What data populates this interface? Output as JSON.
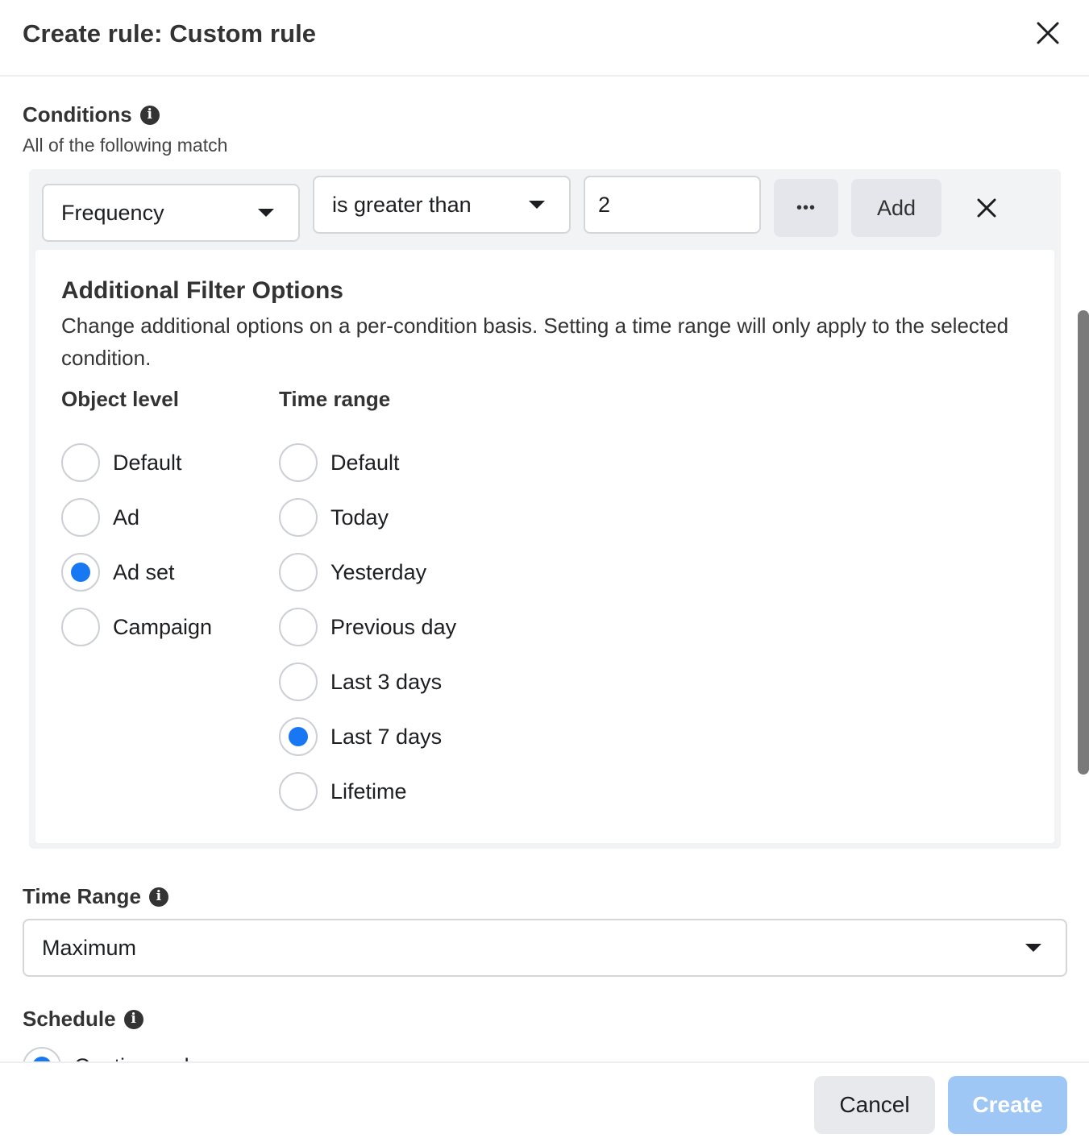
{
  "header": {
    "title": "Create rule: Custom rule",
    "close_icon": "close-icon"
  },
  "conditions": {
    "title": "Conditions",
    "subtitle": "All of the following match",
    "metric_select": "Frequency",
    "operator_select": "is greater than",
    "value_input": "2",
    "more_label": "•••",
    "add_label": "Add"
  },
  "filter_options": {
    "title": "Additional Filter Options",
    "description": "Change additional options on a per-condition basis. Setting a time range will only apply to the selected condition.",
    "object_level": {
      "title": "Object level",
      "options": [
        "Default",
        "Ad",
        "Ad set",
        "Campaign"
      ],
      "selected": "Ad set"
    },
    "time_range": {
      "title": "Time range",
      "options": [
        "Default",
        "Today",
        "Yesterday",
        "Previous day",
        "Last 3 days",
        "Last 7 days",
        "Lifetime"
      ],
      "selected": "Last 7 days"
    }
  },
  "time_range": {
    "title": "Time Range",
    "value": "Maximum"
  },
  "schedule": {
    "title": "Schedule",
    "first_option": "Continuously"
  },
  "footer": {
    "cancel_label": "Cancel",
    "create_label": "Create"
  },
  "colors": {
    "accent": "#1877f2",
    "create_disabled": "#9fc7f5"
  }
}
